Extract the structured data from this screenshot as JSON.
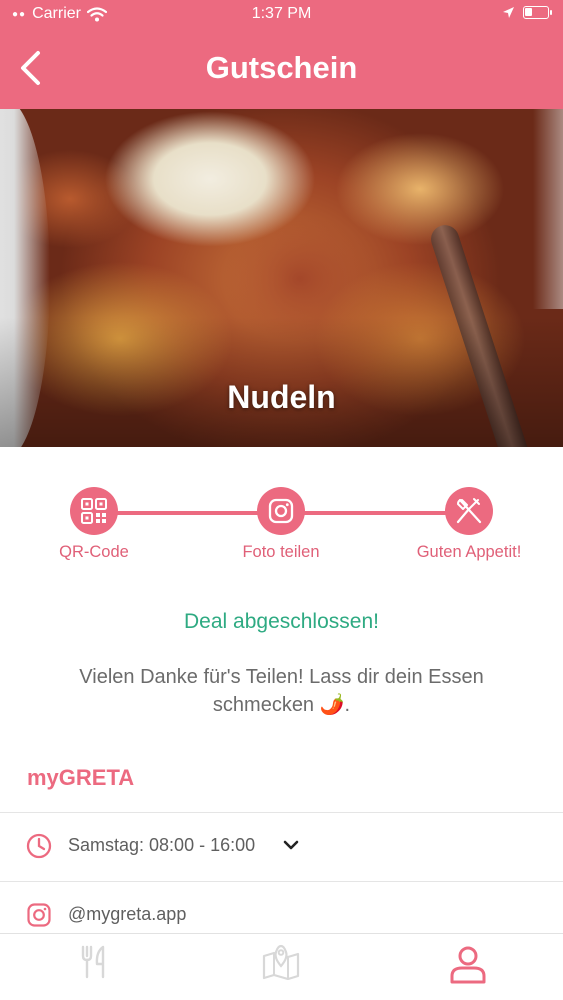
{
  "status_bar": {
    "carrier": "Carrier",
    "time": "1:37 PM",
    "battery_level": 0.35
  },
  "header": {
    "title": "Gutschein",
    "back_icon": "chevron-left-icon",
    "color": "#ec6a80"
  },
  "hero": {
    "title": "Nudeln"
  },
  "steps": [
    {
      "label": "QR-Code",
      "icon": "qr-code-icon"
    },
    {
      "label": "Foto teilen",
      "icon": "instagram-icon"
    },
    {
      "label": "Guten Appetit!",
      "icon": "fork-knife-icon"
    }
  ],
  "deal": {
    "status": "Deal abgeschlossen!",
    "status_color": "#2eaa82",
    "message": "Vielen Danke für's Teilen! Lass dir dein Essen schmecken 🌶️."
  },
  "restaurant": {
    "name": "myGRETA",
    "hours": "Samstag: 08:00 - 16:00",
    "instagram": "@mygreta.app"
  },
  "tabbar": {
    "items": [
      {
        "icon": "restaurant-icon",
        "active": false
      },
      {
        "icon": "map-icon",
        "active": false
      },
      {
        "icon": "profile-icon",
        "active": true
      }
    ]
  }
}
